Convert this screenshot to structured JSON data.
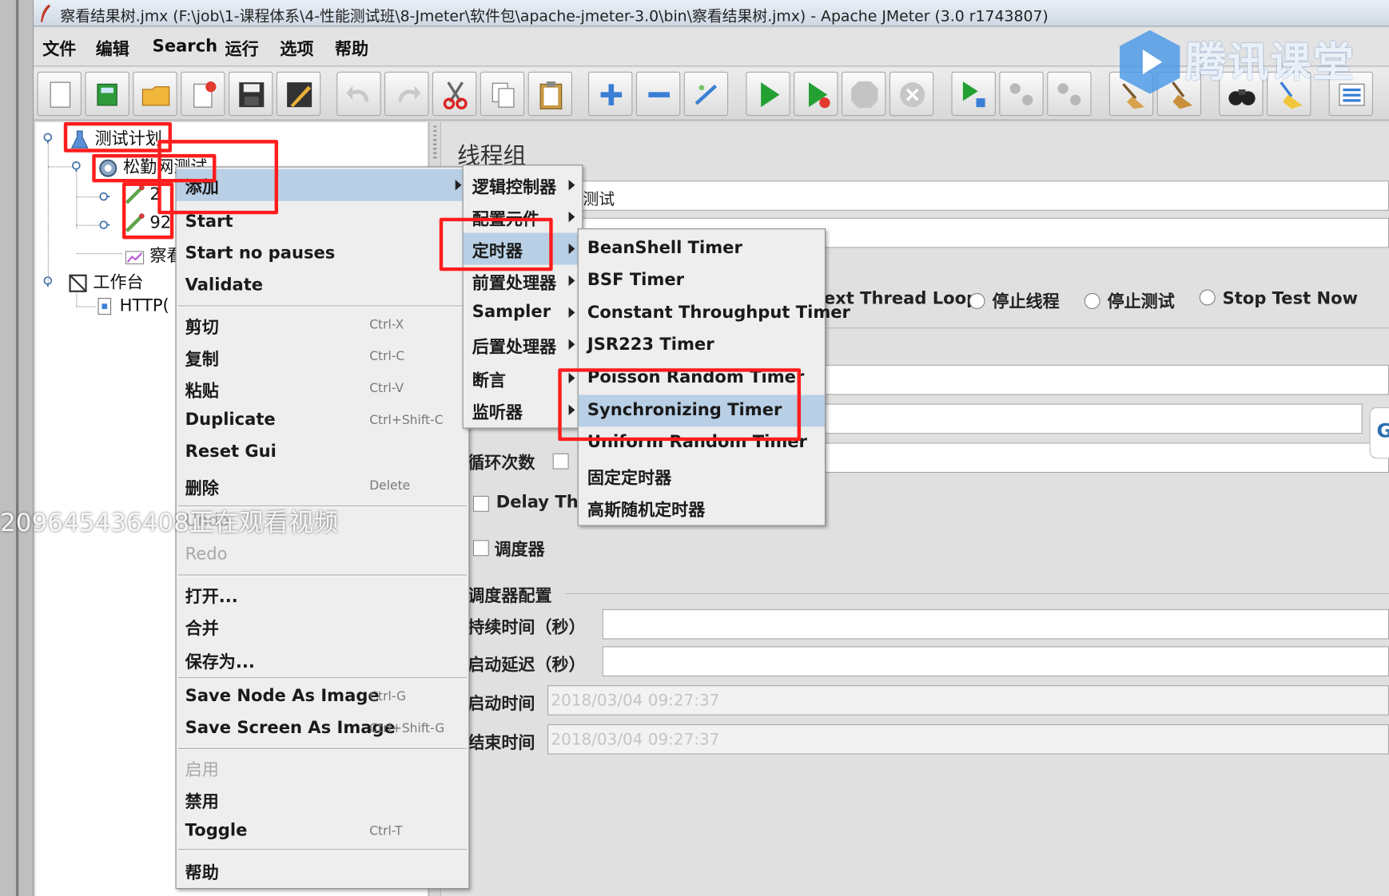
{
  "window": {
    "title": "察看结果树.jmx (F:\\job\\1-课程体系\\4-性能测试班\\8-Jmeter\\软件包\\apache-jmeter-3.0\\bin\\察看结果树.jmx) - Apache JMeter (3.0 r1743807)"
  },
  "menubar": [
    "文件",
    "编辑",
    "Search",
    "运行",
    "选项",
    "帮助"
  ],
  "watermark": {
    "brand": "腾讯课堂",
    "viewer": "209645436408正在观看视频"
  },
  "tree": {
    "test_plan": "测试计划",
    "thread_group": "松勤网测试",
    "child1": "2",
    "child2": "92",
    "child3": "察看",
    "workbench": "工作台",
    "http": "HTTP("
  },
  "panel": {
    "title": "线程组",
    "name_value": "测试",
    "after_error": {
      "continue_next": "ext Thread Loop",
      "stop_thread": "停止线程",
      "stop_test": "停止测试",
      "stop_now": "Stop Test Now"
    },
    "loop_count": "循环次数",
    "delay_thread": "Delay Thre",
    "scheduler": "调度器",
    "scheduler_config": "调度器配置",
    "duration": "持续时间（秒）",
    "startup_delay": "启动延迟（秒）",
    "start_time": "启动时间",
    "start_time_value": "2018/03/04 09:27:37",
    "end_time": "结束时间",
    "end_time_value": "2018/03/04 09:27:37"
  },
  "context_menu": [
    {
      "label": "添加",
      "shortcut": "",
      "selected": true,
      "submenu": true
    },
    {
      "label": "Start",
      "shortcut": ""
    },
    {
      "label": "Start no pauses",
      "shortcut": ""
    },
    {
      "label": "Validate",
      "shortcut": ""
    },
    {
      "label": "剪切",
      "shortcut": "Ctrl-X"
    },
    {
      "label": "复制",
      "shortcut": "Ctrl-C"
    },
    {
      "label": "粘贴",
      "shortcut": "Ctrl-V"
    },
    {
      "label": "Duplicate",
      "shortcut": "Ctrl+Shift-C"
    },
    {
      "label": "Reset Gui",
      "shortcut": ""
    },
    {
      "label": "删除",
      "shortcut": "Delete"
    },
    {
      "label": "Undo",
      "shortcut": "",
      "disabled": true
    },
    {
      "label": "Redo",
      "shortcut": "",
      "disabled": true
    },
    {
      "label": "打开...",
      "shortcut": ""
    },
    {
      "label": "合并",
      "shortcut": ""
    },
    {
      "label": "保存为...",
      "shortcut": ""
    },
    {
      "label": "Save Node As Image",
      "shortcut": "Ctrl-G"
    },
    {
      "label": "Save Screen As Image",
      "shortcut": "Ctrl+Shift-G"
    },
    {
      "label": "启用",
      "shortcut": "",
      "disabled": true
    },
    {
      "label": "禁用",
      "shortcut": ""
    },
    {
      "label": "Toggle",
      "shortcut": "Ctrl-T"
    },
    {
      "label": "帮助",
      "shortcut": ""
    }
  ],
  "add_submenu": [
    {
      "label": "逻辑控制器"
    },
    {
      "label": "配置元件"
    },
    {
      "label": "定时器",
      "selected": true
    },
    {
      "label": "前置处理器"
    },
    {
      "label": "Sampler"
    },
    {
      "label": "后置处理器"
    },
    {
      "label": "断言"
    },
    {
      "label": "监听器"
    }
  ],
  "timer_submenu": [
    {
      "label": "BeanShell Timer"
    },
    {
      "label": "BSF Timer"
    },
    {
      "label": "Constant Throughput Timer"
    },
    {
      "label": "JSR223 Timer"
    },
    {
      "label": "Poisson Random Timer"
    },
    {
      "label": "Synchronizing Timer",
      "selected": true
    },
    {
      "label": "Uniform Random Timer"
    },
    {
      "label": "固定定时器"
    },
    {
      "label": "高斯随机定时器"
    }
  ],
  "colors": {
    "highlight": "#b8cfe5",
    "annotation_red": "#ff1d1d"
  },
  "edge_button_glyph": "G"
}
